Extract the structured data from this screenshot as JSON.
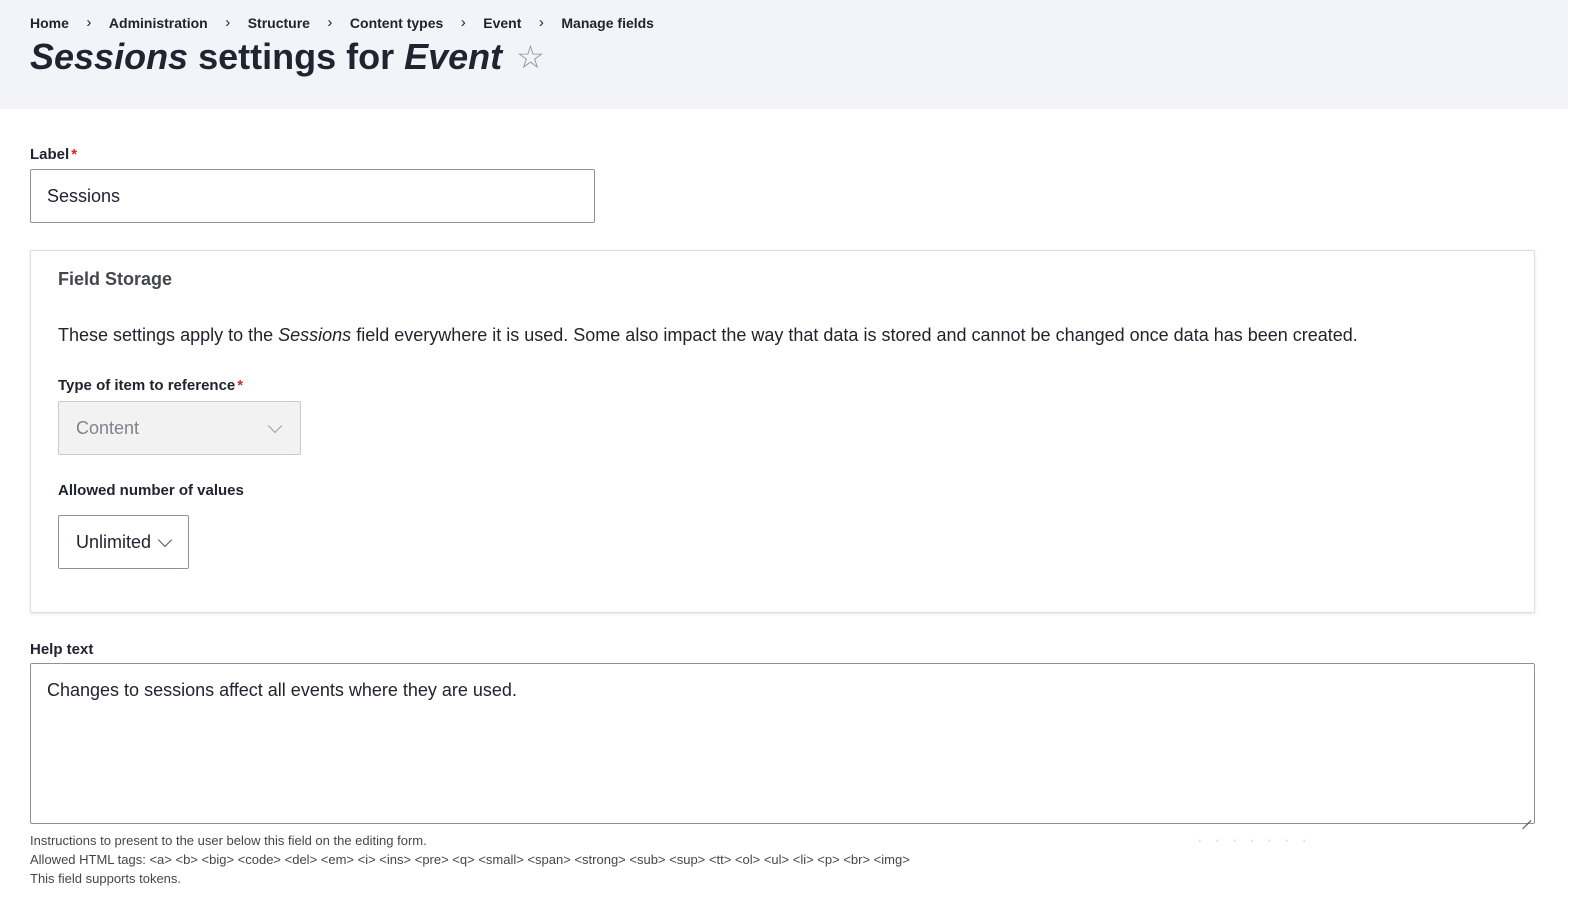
{
  "breadcrumb": {
    "items": [
      "Home",
      "Administration",
      "Structure",
      "Content types",
      "Event",
      "Manage fields"
    ],
    "separator": "›"
  },
  "title": {
    "part1": "Sessions",
    "part2": " settings for ",
    "part3": "Event",
    "shortcut_icon": "☆"
  },
  "label_field": {
    "label": "Label",
    "required_marker": "*",
    "value": "Sessions"
  },
  "field_storage": {
    "legend": "Field Storage",
    "description_before": "These settings apply to the ",
    "description_emphasis": "Sessions",
    "description_after": " field everywhere it is used. Some also impact the way that data is stored and cannot be changed once data has been created.",
    "type_label": "Type of item to reference",
    "type_required_marker": "*",
    "type_value": "Content",
    "allowed_label": "Allowed number of values",
    "allowed_value": "Unlimited"
  },
  "help_text": {
    "label": "Help text",
    "value": "Changes to sessions affect all events where they are used.",
    "instructions": "Instructions to present to the user below this field on the editing form.",
    "allowed_tags": "Allowed HTML tags: <a> <b> <big> <code> <del> <em> <i> <ins> <pre> <q> <small> <span> <strong> <sub> <sup> <tt> <ol> <ul> <li> <p> <br> <img>",
    "tokens_note": "This field supports tokens."
  },
  "colors": {
    "header_bg": "#f3f4f9",
    "text": "#222330",
    "required": "#dc2323",
    "border": "#8e929c"
  }
}
